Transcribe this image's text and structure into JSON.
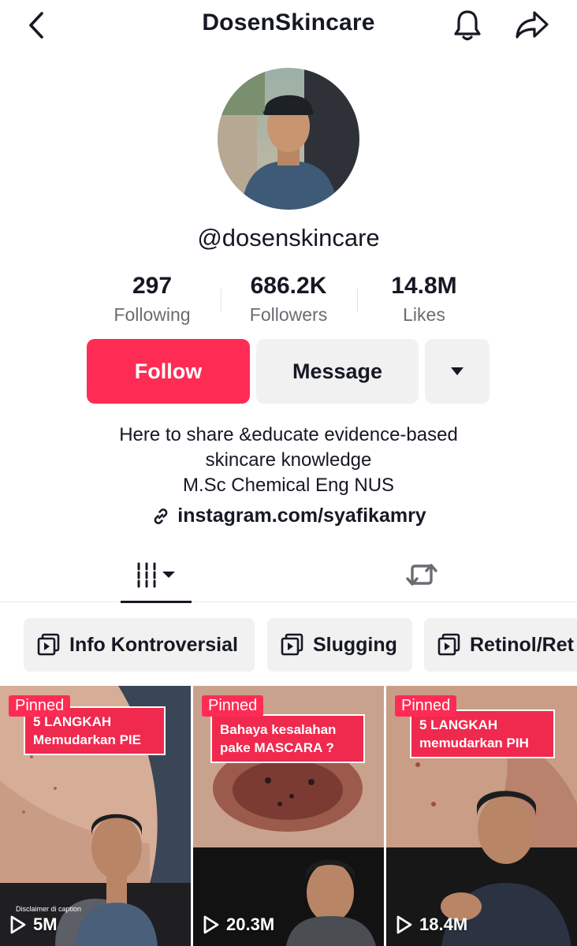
{
  "header": {
    "title": "DosenSkincare",
    "back_icon": "chevron-left-icon",
    "bell_icon": "bell-icon",
    "share_icon": "share-arrow-icon"
  },
  "profile": {
    "username": "@dosenskincare",
    "stats": [
      {
        "value": "297",
        "label": "Following"
      },
      {
        "value": "686.2K",
        "label": "Followers"
      },
      {
        "value": "14.8M",
        "label": "Likes"
      }
    ],
    "buttons": {
      "follow": "Follow",
      "message": "Message"
    },
    "bio": [
      "Here to share &educate evidence-based",
      "skincare knowledge",
      "M.Sc Chemical Eng NUS"
    ],
    "link": "instagram.com/syafikamry"
  },
  "tabs": {
    "videos_icon": "grid-icon",
    "reposts_icon": "repost-icon"
  },
  "playlists": [
    {
      "label": "Info Kontroversial"
    },
    {
      "label": "Slugging"
    },
    {
      "label": "Retinol/Ret"
    }
  ],
  "videos": [
    {
      "badge": "Pinned",
      "caption": [
        "5 LANGKAH",
        "Memudarkan PIE"
      ],
      "views": "5M",
      "disclaimer": "Disclaimer di caption"
    },
    {
      "badge": "Pinned",
      "caption": [
        "Bahaya kesalahan",
        "pake MASCARA ?"
      ],
      "views": "20.3M"
    },
    {
      "badge": "Pinned",
      "caption": [
        "5 LANGKAH",
        "memudarkan PIH"
      ],
      "views": "18.4M"
    }
  ],
  "colors": {
    "accent": "#fe2c55",
    "secondary_bg": "#f1f1f2",
    "text": "#161823",
    "muted": "#6b6c72"
  }
}
